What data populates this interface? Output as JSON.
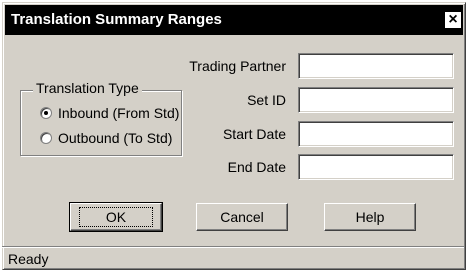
{
  "window": {
    "title": "Translation Summary Ranges",
    "close_glyph": "✕"
  },
  "group": {
    "legend": "Translation Type",
    "options": [
      {
        "label": "Inbound (From Std)",
        "checked": true
      },
      {
        "label": "Outbound (To Std)",
        "checked": false
      }
    ]
  },
  "fields": {
    "trading_partner": {
      "label": "Trading Partner",
      "value": ""
    },
    "set_id": {
      "label": "Set ID",
      "value": ""
    },
    "start_date": {
      "label": "Start Date",
      "value": ""
    },
    "end_date": {
      "label": "End Date",
      "value": ""
    }
  },
  "buttons": {
    "ok": "OK",
    "cancel": "Cancel",
    "help": "Help"
  },
  "status": {
    "text": "Ready"
  }
}
